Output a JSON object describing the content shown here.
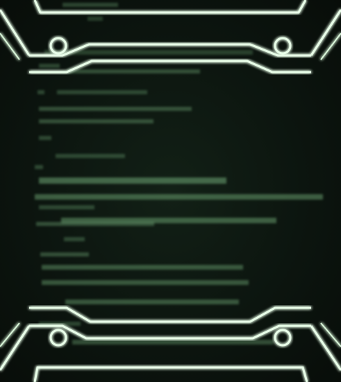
{
  "colors": {
    "background": "#0b120d",
    "code_text": "#7fbf86",
    "frame_glow": "#e9ffe9",
    "frame_shadow": "#4caf50"
  },
  "scene": {
    "description_icons": [
      "bolt-circle-icon",
      "bolt-circle-icon",
      "bolt-circle-icon",
      "bolt-circle-icon"
    ]
  }
}
